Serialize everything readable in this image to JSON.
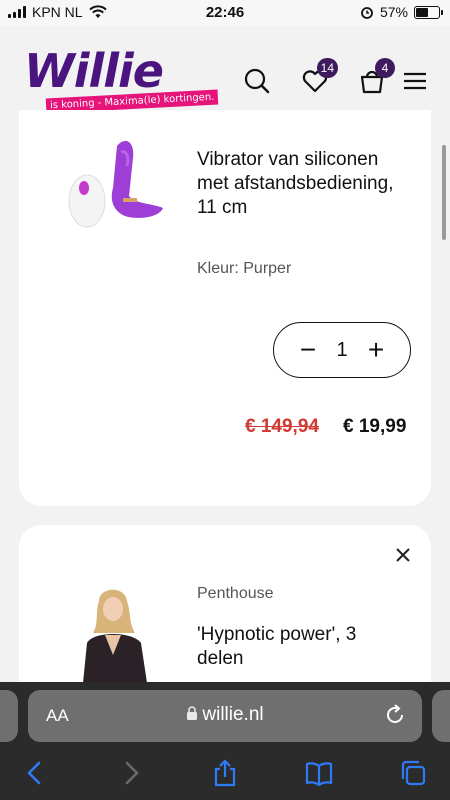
{
  "status_bar": {
    "carrier": "KPN NL",
    "time": "22:46",
    "battery": "57%",
    "battery_level": 0.57
  },
  "header": {
    "logo_text": "Willie",
    "logo_tagline": "is koning - Maxima(le) kortingen.",
    "wishlist_count": "14",
    "cart_count": "4"
  },
  "cart_items": [
    {
      "title": "Vibrator van siliconen met afstandsbediening, 11 cm",
      "color_label": "Kleur: Purper",
      "quantity": "1",
      "old_price": "€ 149,94",
      "new_price": "€ 19,99"
    },
    {
      "brand": "Penthouse",
      "title": "'Hypnotic power', 3 delen"
    }
  ],
  "browser": {
    "aa_label": "AA",
    "url": "willie.nl"
  },
  "colors": {
    "brand_purple": "#4b1580",
    "brand_pink": "#e5137a",
    "price_red": "#d23a34",
    "badge": "#3f1a5f",
    "ios_blue": "#2f7bf6"
  }
}
